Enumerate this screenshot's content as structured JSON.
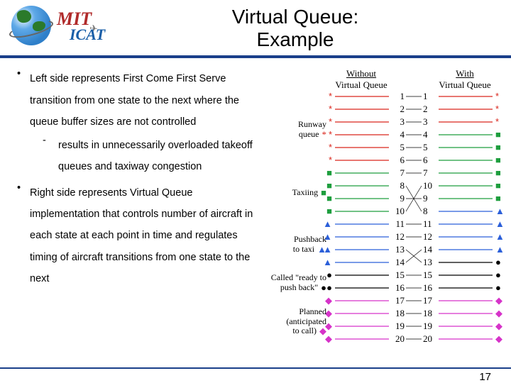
{
  "logo": {
    "mit": "MIT",
    "icat": "ICAT"
  },
  "title": {
    "line1": "Virtual Queue:",
    "line2": "Example"
  },
  "bullets": {
    "b1": "Left side represents First Come First Serve transition from one state to the next where the queue buffer sizes are not controlled",
    "b1sub": "results in unnecessarily overloaded takeoff queues and taxiway congestion",
    "b2": "Right side represents Virtual Queue implementation that controls number of aircraft in each state at each point in time and regulates timing of aircraft transitions from one state to the next"
  },
  "diagram": {
    "col1": {
      "line1": "Without",
      "line2": "Virtual Queue"
    },
    "col2": {
      "line1": "With",
      "line2": "Virtual Queue"
    },
    "states": {
      "runway": "Runway queue",
      "taxiing": "Taxiing",
      "pushback": "Pushback to taxi",
      "ready": "Called \"ready to push back\"",
      "planned": "Planned (anticipated to call)"
    },
    "chart_data": {
      "type": "table",
      "aircraft_ids": [
        1,
        2,
        3,
        4,
        5,
        6,
        7,
        8,
        9,
        10,
        11,
        12,
        13,
        14,
        15,
        16,
        17,
        18,
        19,
        20
      ],
      "states": [
        "runway_queue",
        "taxiing",
        "pushback_to_taxi",
        "ready_to_push",
        "planned"
      ],
      "without_virtual_queue": [
        "runway_queue",
        "runway_queue",
        "runway_queue",
        "runway_queue",
        "runway_queue",
        "runway_queue",
        "taxiing",
        "taxiing",
        "taxiing",
        "taxiing",
        "pushback_to_taxi",
        "pushback_to_taxi",
        "pushback_to_taxi",
        "pushback_to_taxi",
        "ready_to_push",
        "ready_to_push",
        "planned",
        "planned",
        "planned",
        "planned"
      ],
      "with_virtual_queue": [
        "runway_queue",
        "runway_queue",
        "runway_queue",
        "taxiing",
        "taxiing",
        "taxiing",
        "taxiing",
        "pushback_to_taxi",
        "taxiing",
        "taxiing",
        "pushback_to_taxi",
        "pushback_to_taxi",
        "ready_to_push",
        "pushback_to_taxi",
        "ready_to_push",
        "ready_to_push",
        "planned",
        "planned",
        "planned",
        "planned"
      ],
      "legend": {
        "runway_queue": "*",
        "taxiing": "■",
        "pushback_to_taxi": "▲",
        "ready_to_push": "●",
        "planned": "◆"
      },
      "colors": {
        "runway_queue": "#d9261c",
        "taxiing": "#1e9e3e",
        "pushback_to_taxi": "#2b5fd9",
        "ready_to_push": "#000",
        "planned": "#d633c9"
      }
    }
  },
  "pagenum": "17"
}
